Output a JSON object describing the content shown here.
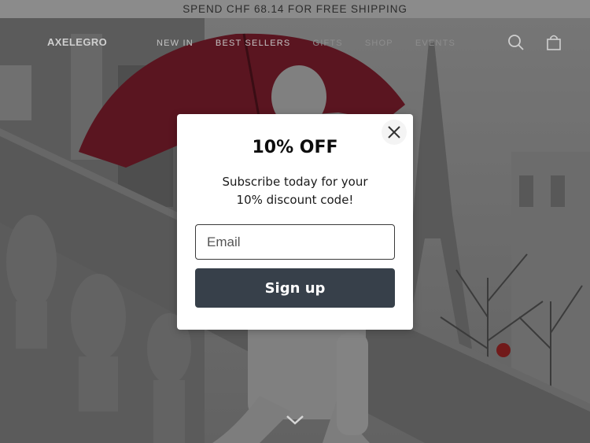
{
  "announcement": {
    "text": "SPEND CHF 68.14 FOR FREE SHIPPING"
  },
  "header": {
    "logo": "AXELEGRO",
    "nav": [
      {
        "label": "NEW IN"
      },
      {
        "label": "BEST SELLERS"
      },
      {
        "label": "GIFTS"
      },
      {
        "label": "SHOP"
      },
      {
        "label": "EVENTS"
      }
    ],
    "icons": {
      "search": "search-icon",
      "cart": "shopping-bag-icon"
    }
  },
  "popup": {
    "title": "10% OFF",
    "text_line1": "Subscribe today for your",
    "text_line2": "10% discount code!",
    "email_placeholder": "Email",
    "signup_label": "Sign up",
    "close_icon": "close-icon"
  },
  "hero": {
    "scroll_icon": "chevron-down-icon"
  },
  "colors": {
    "button_bg": "#37404a",
    "popup_bg": "#ffffff",
    "announcement_bg": "#8b8b8b",
    "umbrella": "#8e2232"
  }
}
